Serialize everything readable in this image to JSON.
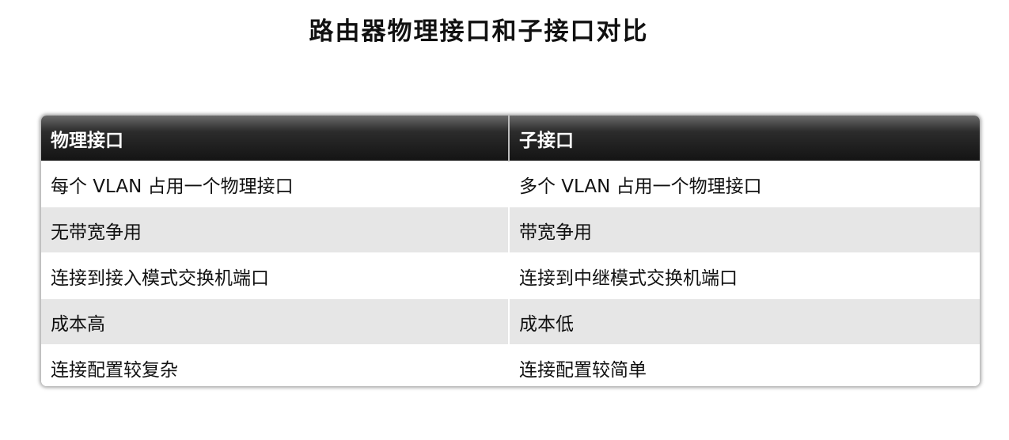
{
  "title": "路由器物理接口和子接口对比",
  "table": {
    "headers": [
      "物理接口",
      "子接口"
    ],
    "rows": [
      [
        "每个 VLAN 占用一个物理接口",
        "多个 VLAN 占用一个物理接口"
      ],
      [
        "无带宽争用",
        "带宽争用"
      ],
      [
        "连接到接入模式交换机端口",
        "连接到中继模式交换机端口"
      ],
      [
        "成本高",
        "成本低"
      ],
      [
        "连接配置较复杂",
        "连接配置较简单"
      ]
    ]
  }
}
